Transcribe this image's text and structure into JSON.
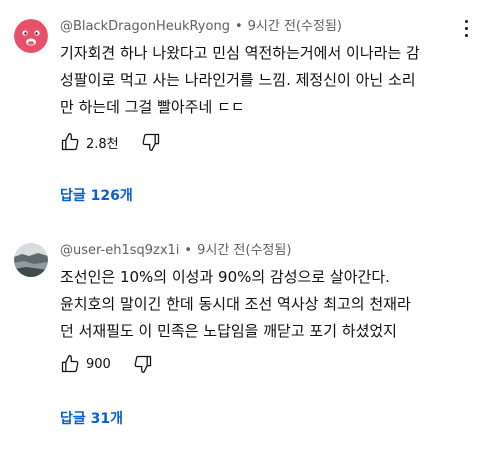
{
  "comments": [
    {
      "author": "@BlackDragonHeukRyong",
      "separator": "•",
      "time": "9시간 전(수정됨)",
      "lines": [
        "기자회견 하나 나왔다고 민심 역전하는거에서 이나라는 감",
        "성팔이로 먹고 사는 나라인거를 느낌. 제정신이 아닌 소리",
        "만 하는데 그걸 빨아주네 ㄷㄷ"
      ],
      "likes": "2.8천",
      "replies_label": "답글 126개",
      "avatar_color": "#e8506a"
    },
    {
      "author": "@user-eh1sq9zx1i",
      "separator": "•",
      "time": "9시간 전(수정됨)",
      "lines": [
        "조선인은 10%의 이성과 90%의 감성으로 살아간다.",
        "윤치호의 말이긴 한데 동시대 조선 역사상 최고의 천재라",
        "던 서재필도 이 민족은 노답임을 깨닫고 포기 하셨었지"
      ],
      "likes": "900",
      "replies_label": "답글 31개",
      "avatar_color": "#7a8a90"
    }
  ],
  "colors": {
    "text": "#0f0f0f",
    "meta": "#606060",
    "link": "#065fd4"
  },
  "icons": {
    "like": "thumbs-up-icon",
    "dislike": "thumbs-down-icon",
    "more": "vertical-ellipsis-icon"
  }
}
